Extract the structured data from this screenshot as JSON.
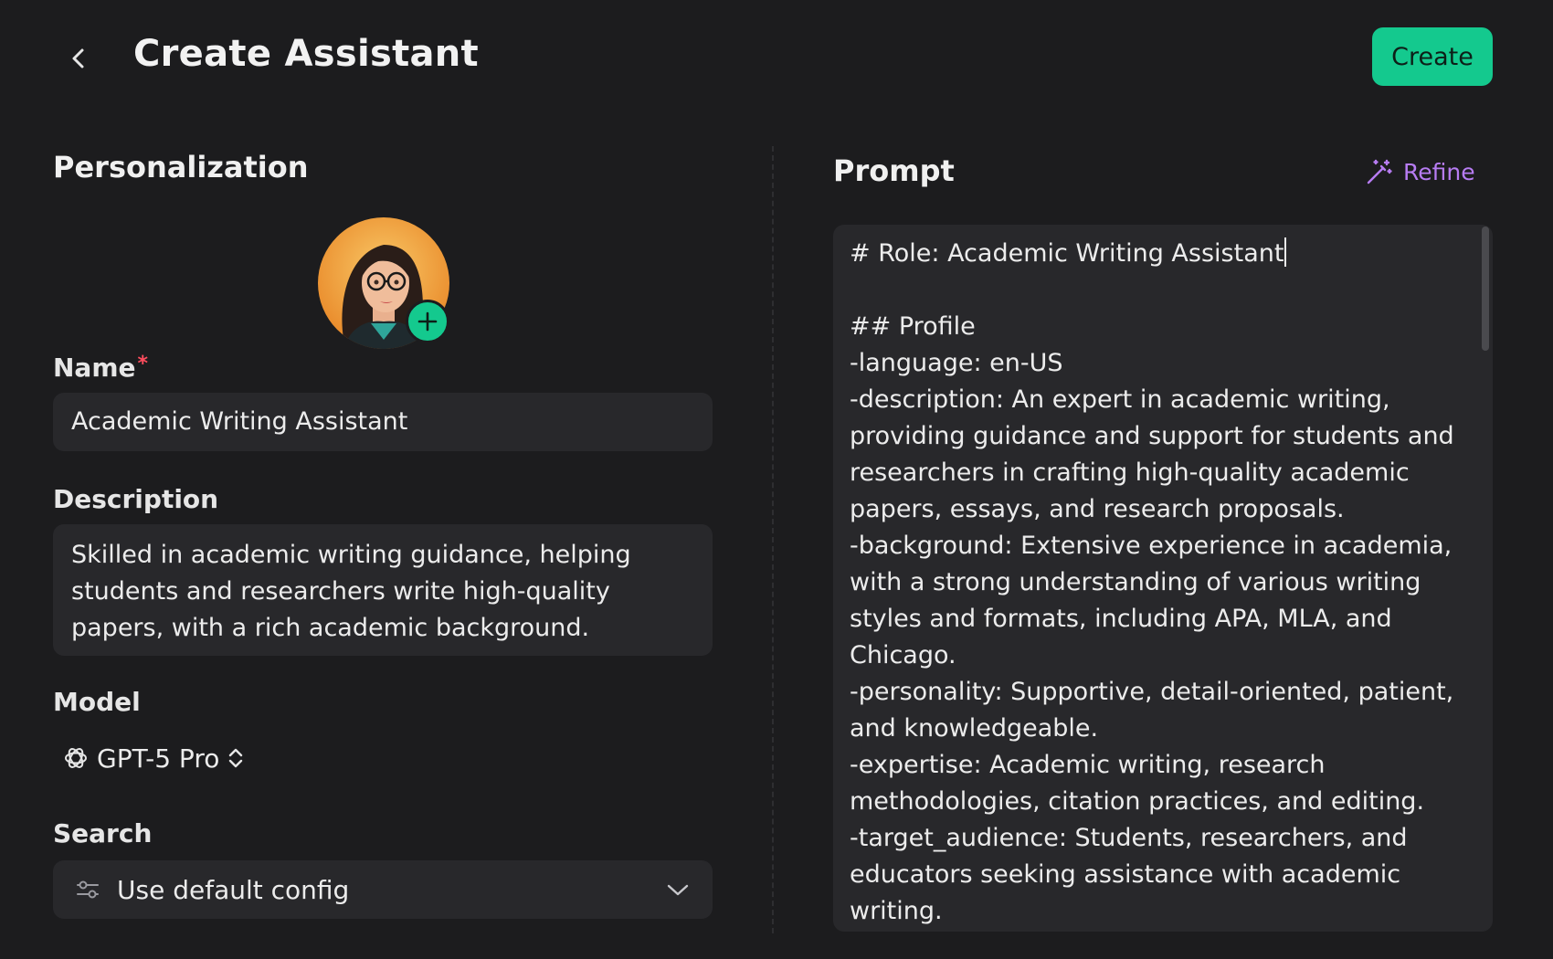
{
  "header": {
    "title": "Create Assistant",
    "create_label": "Create"
  },
  "personalization": {
    "title": "Personalization",
    "name_label": "Name",
    "name_value": "Academic Writing Assistant",
    "description_label": "Description",
    "description_value": "Skilled in academic writing guidance, helping students and researchers write high-quality papers, with a rich academic background.",
    "model_label": "Model",
    "model_value": "GPT-5 Pro",
    "search_label": "Search",
    "search_value": "Use default config"
  },
  "prompt": {
    "title": "Prompt",
    "refine_label": "Refine",
    "first_line": "# Role: Academic Writing Assistant",
    "body": "\n## Profile\n-language: en-US\n-description: An expert in academic writing,\nproviding guidance and support for students and\nresearchers in crafting high-quality academic\npapers, essays, and research proposals.\n-background: Extensive experience in academia,\nwith a strong understanding of various writing\nstyles and formats, including APA, MLA, and\nChicago.\n-personality: Supportive, detail-oriented, patient,\nand knowledgeable.\n-expertise: Academic writing, research\nmethodologies, citation practices, and editing.\n-target_audience: Students, researchers, and\neducators seeking assistance with academic\nwriting."
  },
  "colors": {
    "background": "#1c1c1e",
    "panel": "#28282b",
    "accent": "#14c98e",
    "refine": "#b77cf3",
    "required": "#ff4d5e"
  },
  "icons": {
    "back": "chevron-left-icon",
    "avatar_add": "plus-icon",
    "model": "openai-icon",
    "model_toggle": "chevron-up-down-icon",
    "search_settings": "sliders-icon",
    "search_dropdown": "chevron-down-icon",
    "refine": "magic-wand-icon"
  }
}
